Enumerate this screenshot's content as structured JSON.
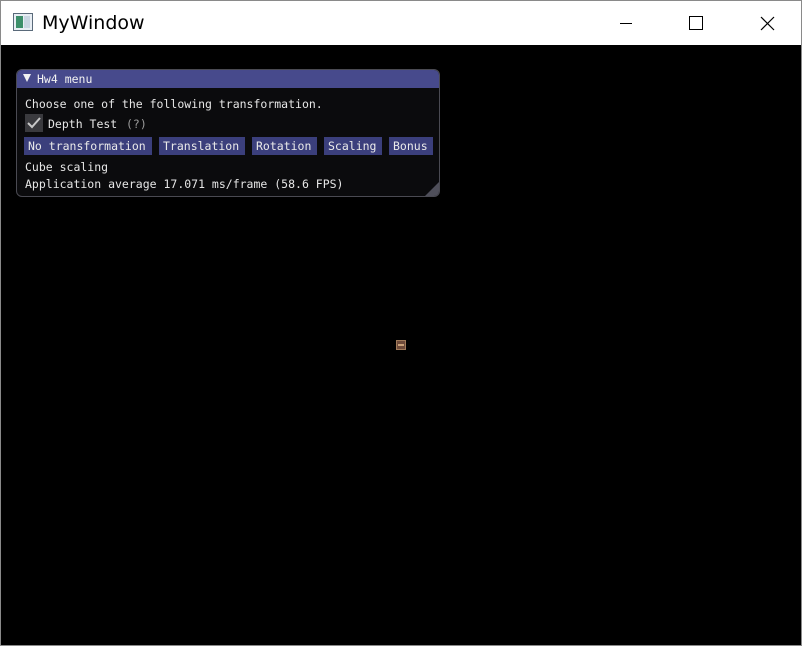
{
  "window": {
    "title": "MyWindow",
    "controls": {
      "minimize_icon": "minimize-icon",
      "maximize_icon": "maximize-icon",
      "close_icon": "close-icon"
    }
  },
  "imgui": {
    "title": "Hw4 menu",
    "prompt": "Choose one of the following transformation.",
    "depth_test": {
      "label": "Depth Test",
      "help": "(?)",
      "checked": true
    },
    "buttons": [
      "No transformation",
      "Translation",
      "Rotation",
      "Scaling",
      "Bonus"
    ],
    "status": "Cube scaling",
    "fps_text": "Application average 17.071 ms/frame (58.6 FPS)",
    "colors": {
      "title_bg": "#474a8c",
      "button_bg": "#3b3f7c",
      "panel_bg": "#0c0c0e"
    }
  },
  "scene": {
    "background": "#000000",
    "object": "cube"
  }
}
